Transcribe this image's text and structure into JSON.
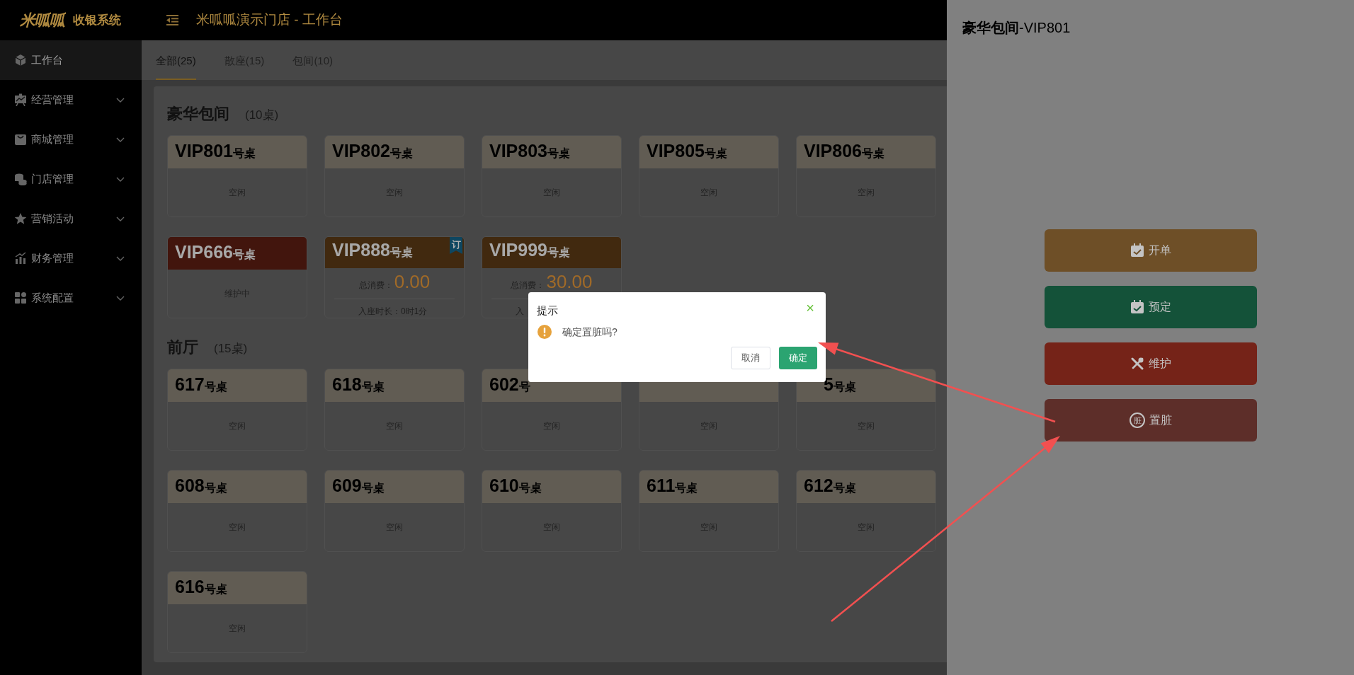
{
  "header": {
    "logo": "米呱呱",
    "system": "收银系统",
    "title": "米呱呱演示门店 - 工作台"
  },
  "sidebar": {
    "items": [
      {
        "label": "工作台",
        "kind": "link",
        "selected": true
      },
      {
        "label": "经营管理",
        "kind": "group",
        "selected": false
      },
      {
        "label": "商城管理",
        "kind": "group",
        "selected": false
      },
      {
        "label": "门店管理",
        "kind": "group",
        "selected": false
      },
      {
        "label": "营销活动",
        "kind": "group",
        "selected": false
      },
      {
        "label": "财务管理",
        "kind": "group",
        "selected": false
      },
      {
        "label": "系统配置",
        "kind": "group",
        "selected": false
      }
    ]
  },
  "tabs": [
    {
      "label": "全部(25)",
      "selected": true
    },
    {
      "label": "散座(15)",
      "selected": false
    },
    {
      "label": "包间(10)",
      "selected": false
    }
  ],
  "sections": [
    {
      "title": "豪华包间",
      "count": "(10桌)",
      "tables": [
        {
          "kind": "idle",
          "name": "VIP801",
          "suffix": "号桌",
          "status": "空闲"
        },
        {
          "kind": "idle",
          "name": "VIP802",
          "suffix": "号桌",
          "status": "空闲"
        },
        {
          "kind": "idle",
          "name": "VIP803",
          "suffix": "号桌",
          "status": "空闲"
        },
        {
          "kind": "idle",
          "name": "VIP805",
          "suffix": "号桌",
          "status": "空闲"
        },
        {
          "kind": "idle",
          "name": "VIP806",
          "suffix": "号桌",
          "status": "空闲"
        },
        {
          "kind": "maintenance",
          "name": "VIP666",
          "suffix": "号桌",
          "status": "维护中"
        },
        {
          "kind": "occupied",
          "name": "VIP888",
          "suffix": "号桌",
          "badge": "订",
          "spend_label": "总消费：",
          "spend": "0.00",
          "duration": "入座时长：0时1分"
        },
        {
          "kind": "occupied",
          "name": "VIP999",
          "suffix": "号桌",
          "spend_label": "总消费：",
          "spend": "30.00",
          "duration": "入"
        }
      ]
    },
    {
      "title": "前厅",
      "count": "(15桌)",
      "tables": [
        {
          "kind": "idle",
          "name": "617",
          "suffix": "号桌",
          "status": "空闲"
        },
        {
          "kind": "idle",
          "name": "618",
          "suffix": "号桌",
          "status": "空闲"
        },
        {
          "kind": "idle",
          "name": "602",
          "suffix": "号",
          "status": "空闲"
        },
        {
          "kind": "idle",
          "status": "空闲"
        },
        {
          "kind": "idle",
          "name": "5",
          "suffix": "号桌",
          "covered_left": true,
          "status": "空闲"
        },
        {
          "kind": "idle",
          "name": "608",
          "suffix": "号桌",
          "status": "空闲"
        },
        {
          "kind": "idle",
          "name": "609",
          "suffix": "号桌",
          "status": "空闲"
        },
        {
          "kind": "idle",
          "name": "610",
          "suffix": "号桌",
          "status": "空闲"
        },
        {
          "kind": "idle",
          "name": "611",
          "suffix": "号桌",
          "status": "空闲"
        },
        {
          "kind": "idle",
          "name": "612",
          "suffix": "号桌",
          "status": "空闲"
        },
        {
          "kind": "idle",
          "name": "616",
          "suffix": "号桌",
          "status": "空闲"
        }
      ]
    }
  ],
  "drawer": {
    "title": "**豪华包间**-VIP801",
    "buttons": [
      {
        "label": "开单",
        "color": "#6e4f27"
      },
      {
        "label": "预定",
        "color": "#145239"
      },
      {
        "label": "维护",
        "color": "#752318"
      },
      {
        "label": "置脏",
        "glyph": "脏",
        "color": "#5d2e29"
      }
    ]
  },
  "dialog": {
    "title": "提示",
    "close": "×",
    "message": "确定置脏吗?",
    "buttons": [
      {
        "label": "取消",
        "kind": "secondary"
      },
      {
        "label": "确定",
        "kind": "primary"
      }
    ]
  }
}
